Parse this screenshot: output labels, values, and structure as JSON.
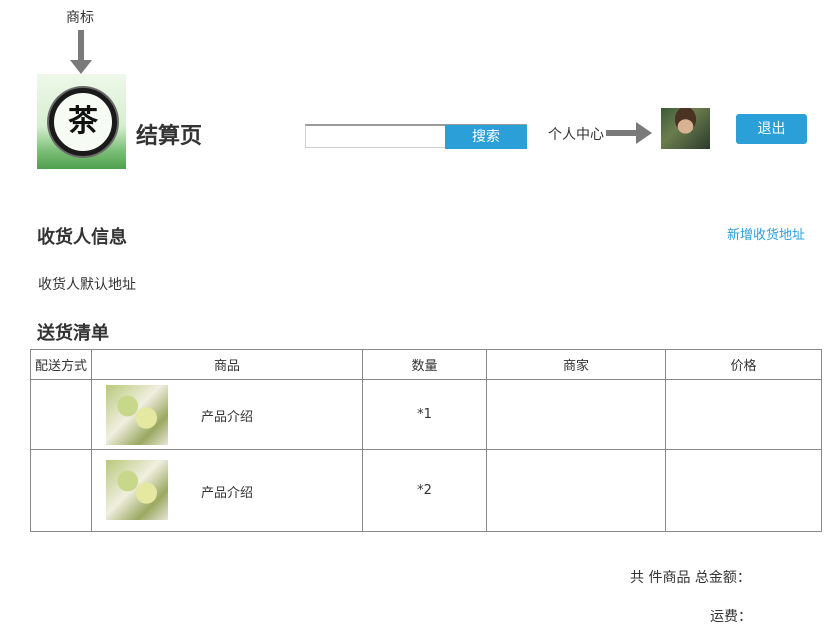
{
  "header": {
    "logo_annotation": "商标",
    "logo_char": "茶",
    "page_title": "结算页",
    "search": {
      "value": "",
      "placeholder": "",
      "button_label": "搜索"
    },
    "user_center_label": "个人中心",
    "logout_label": "退出"
  },
  "receiver": {
    "title": "收货人信息",
    "add_address_link": "新增收货地址",
    "default_address": "收货人默认地址"
  },
  "shipping_list": {
    "title": "送货清单",
    "columns": [
      "配送方式",
      "商品",
      "数量",
      "商家",
      "价格"
    ],
    "rows": [
      {
        "delivery": "",
        "product_desc": "产品介绍",
        "quantity": "*1",
        "merchant": "",
        "price": ""
      },
      {
        "delivery": "",
        "product_desc": "产品介绍",
        "quantity": "*2",
        "merchant": "",
        "price": ""
      }
    ]
  },
  "summary": {
    "total_label": "共 件商品 总金额：",
    "shipping_label": "运费："
  },
  "colors": {
    "accent": "#2a9fd8",
    "arrow": "#7a7a7a"
  },
  "icons": [
    "arrow-down-icon",
    "arrow-right-icon",
    "tea-logo",
    "user-avatar"
  ]
}
